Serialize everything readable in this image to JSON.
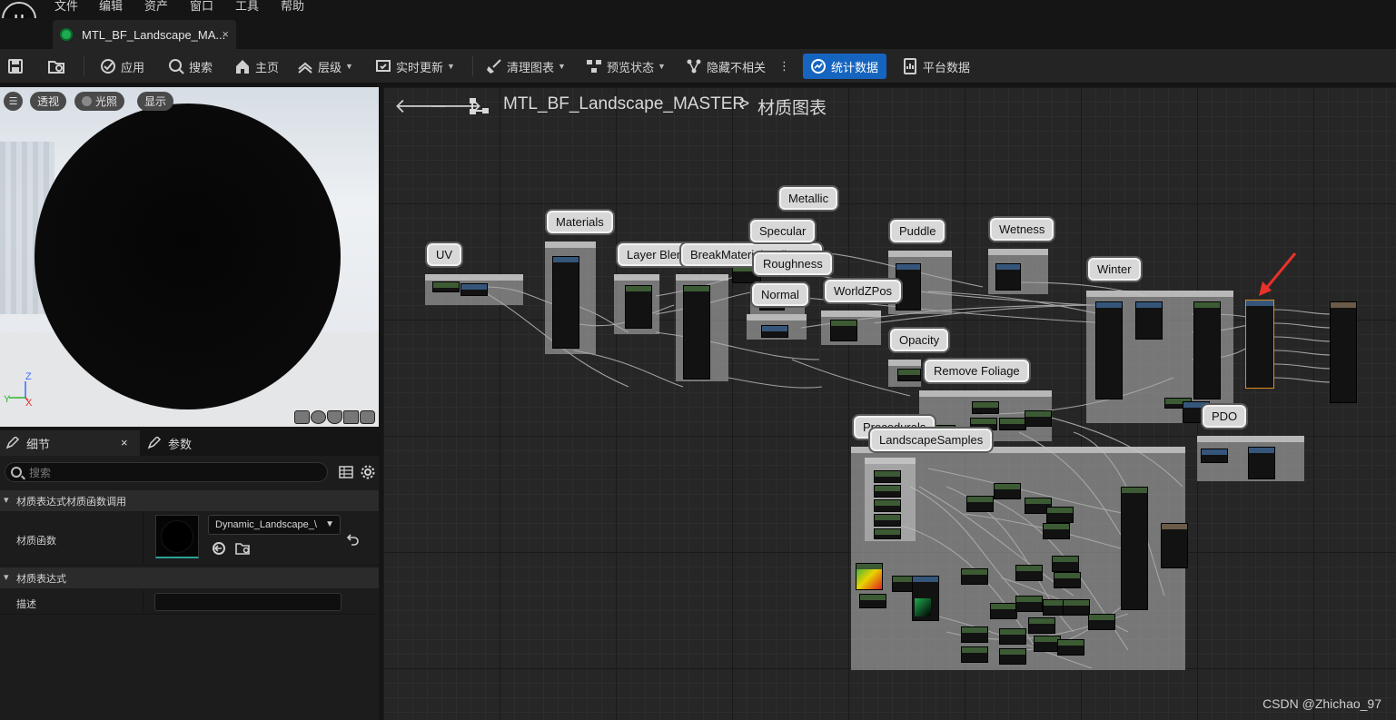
{
  "menu": [
    "文件",
    "编辑",
    "资产",
    "窗口",
    "工具",
    "帮助"
  ],
  "tab": {
    "label": "MTL_BF_Landscape_MA...",
    "close": "×"
  },
  "toolbar": {
    "apply": "应用",
    "search": "搜索",
    "home": "主页",
    "hierarchy": "层级",
    "live_update": "实时更新",
    "clean_graph": "清理图表",
    "preview_state": "预览状态",
    "hide_unrelated": "隐藏不相关",
    "more": "⋮",
    "stats": "统计数据",
    "platform_stats": "平台数据"
  },
  "viewport": {
    "menu": "☰",
    "perspective": "透视",
    "lit": "光照",
    "show": "显示",
    "axis_z": "Z",
    "axis_y": "Y",
    "axis_x": "X"
  },
  "details": {
    "tab_details": "细节",
    "tab_close": "×",
    "tab_params": "参数",
    "search_placeholder": "搜索",
    "section_call": "材质表达式材质函数调用",
    "label_function": "材质函数",
    "function_value": "Dynamic_Landscape_\\",
    "section_expr": "材质表达式",
    "label_desc": "描述"
  },
  "graph": {
    "back": "🡐",
    "forward": "🡒",
    "title": "MTL_BF_Landscape_MASTER",
    "sep": ">",
    "sub": "材质图表",
    "labels": [
      "UV",
      "Materials",
      "Layer Blend",
      "BreakMaterialAttributes",
      "Metallic",
      "Specular",
      "Roughness",
      "Normal",
      "WorldZPos",
      "Puddle",
      "Wetness",
      "Winter",
      "Opacity",
      "Remove Foliage",
      "Procedurals",
      "LandscapeSamples",
      "PDO"
    ],
    "watermark": "CSDN @Zhichao_97"
  },
  "colors": {
    "accent": "#1565c0",
    "selected": "#e08a1e",
    "arrow": "#e8322a"
  }
}
